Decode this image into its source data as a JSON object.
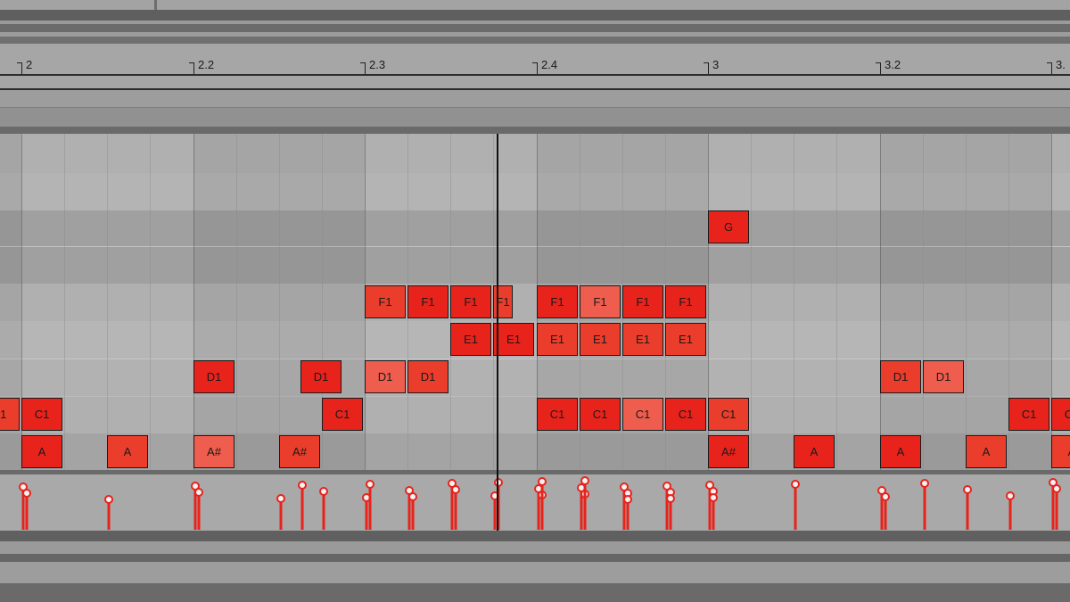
{
  "editor": {
    "ruler_labels": [
      "2",
      "2.2",
      "2.3",
      "2.4",
      "3",
      "3.2",
      "3."
    ],
    "notes": [
      {
        "pitch": "C1",
        "start": 1.9375,
        "end": 2.0
      },
      {
        "pitch": "C1",
        "start": 2.0,
        "end": 2.0625
      },
      {
        "pitch": "A",
        "start": 2.0,
        "end": 2.0625
      },
      {
        "pitch": "A",
        "start": 2.125,
        "end": 2.1875
      },
      {
        "pitch": "D1",
        "start": 2.25,
        "end": 2.3125
      },
      {
        "pitch": "A#",
        "start": 2.25,
        "end": 2.3125
      },
      {
        "pitch": "A#",
        "start": 2.375,
        "end": 2.4375
      },
      {
        "pitch": "D1",
        "start": 2.40625,
        "end": 2.46875
      },
      {
        "pitch": "C1",
        "start": 2.4375,
        "end": 2.5
      },
      {
        "pitch": "F1",
        "start": 2.5,
        "end": 2.5625
      },
      {
        "pitch": "D1",
        "start": 2.5,
        "end": 2.5625
      },
      {
        "pitch": "F1",
        "start": 2.5625,
        "end": 2.625
      },
      {
        "pitch": "D1",
        "start": 2.5625,
        "end": 2.625
      },
      {
        "pitch": "F1",
        "start": 2.625,
        "end": 2.6875
      },
      {
        "pitch": "E1",
        "start": 2.625,
        "end": 2.6875
      },
      {
        "pitch": "F1",
        "start": 2.6875,
        "end": 2.71875
      },
      {
        "pitch": "E1",
        "start": 2.6875,
        "end": 2.75
      },
      {
        "pitch": "F1",
        "start": 2.75,
        "end": 2.8125
      },
      {
        "pitch": "E1",
        "start": 2.75,
        "end": 2.8125
      },
      {
        "pitch": "C1",
        "start": 2.75,
        "end": 2.8125
      },
      {
        "pitch": "F1",
        "start": 2.8125,
        "end": 2.875
      },
      {
        "pitch": "E1",
        "start": 2.8125,
        "end": 2.875
      },
      {
        "pitch": "C1",
        "start": 2.8125,
        "end": 2.875
      },
      {
        "pitch": "F1",
        "start": 2.875,
        "end": 2.9375
      },
      {
        "pitch": "E1",
        "start": 2.875,
        "end": 2.9375
      },
      {
        "pitch": "C1",
        "start": 2.875,
        "end": 2.9375
      },
      {
        "pitch": "F1",
        "start": 2.9375,
        "end": 3.0
      },
      {
        "pitch": "E1",
        "start": 2.9375,
        "end": 3.0
      },
      {
        "pitch": "C1",
        "start": 2.9375,
        "end": 3.0
      },
      {
        "pitch": "G",
        "start": 3.0,
        "end": 3.0625
      },
      {
        "pitch": "C1",
        "start": 3.0,
        "end": 3.0625
      },
      {
        "pitch": "A#",
        "start": 3.0,
        "end": 3.0625
      },
      {
        "pitch": "A",
        "start": 3.125,
        "end": 3.1875
      },
      {
        "pitch": "D1",
        "start": 3.25,
        "end": 3.3125
      },
      {
        "pitch": "A",
        "start": 3.25,
        "end": 3.3125
      },
      {
        "pitch": "D1",
        "start": 3.3125,
        "end": 3.375
      },
      {
        "pitch": "A",
        "start": 3.375,
        "end": 3.4375
      },
      {
        "pitch": "C1",
        "start": 3.4375,
        "end": 3.5
      },
      {
        "pitch": "C1",
        "start": 3.5,
        "end": 3.5625
      },
      {
        "pitch": "A",
        "start": 3.5,
        "end": 3.5625
      }
    ]
  }
}
